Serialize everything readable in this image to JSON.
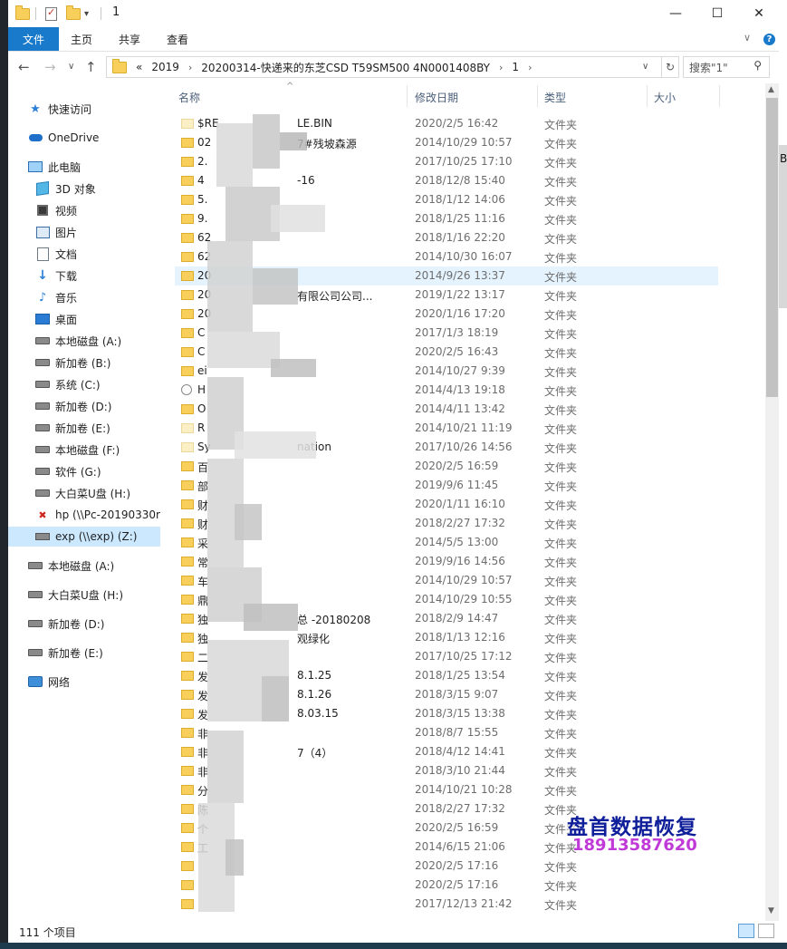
{
  "window": {
    "title": "1",
    "minimize_icon": "minimize-icon",
    "maximize_icon": "maximize-icon",
    "close_icon": "close-icon",
    "min_glyph": "—",
    "max_glyph": "☐",
    "close_glyph": "✕"
  },
  "ribbon": {
    "tabs": [
      "文件",
      "主页",
      "共享",
      "查看"
    ],
    "collapse_glyph": "∨",
    "help_glyph": "?"
  },
  "address": {
    "back_glyph": "←",
    "forward_glyph": "→",
    "recent_glyph": "∨",
    "up_glyph": "↑",
    "overflow": "«",
    "crumbs": [
      "2019",
      "20200314-快递来的东芝CSD T59SM500 4N0001408BY",
      "1"
    ],
    "chevron": "›",
    "dropdown_glyph": "∨",
    "refresh_glyph": "↻",
    "search_placeholder": "搜索\"1\"",
    "search_glyph": "⚲"
  },
  "nav": {
    "items": [
      {
        "label": "快速访问",
        "icon": "star-icon"
      },
      {
        "label": "OneDrive",
        "icon": "cloud-icon"
      },
      {
        "label": "此电脑",
        "icon": "computer-icon"
      },
      {
        "label": "3D 对象",
        "icon": "cube-icon"
      },
      {
        "label": "视频",
        "icon": "video-icon"
      },
      {
        "label": "图片",
        "icon": "picture-icon"
      },
      {
        "label": "文档",
        "icon": "document-icon"
      },
      {
        "label": "下载",
        "icon": "download-icon"
      },
      {
        "label": "音乐",
        "icon": "music-icon"
      },
      {
        "label": "桌面",
        "icon": "desktop-icon"
      },
      {
        "label": "本地磁盘 (A:)",
        "icon": "drive-icon"
      },
      {
        "label": "新加卷 (B:)",
        "icon": "drive-icon"
      },
      {
        "label": "系统 (C:)",
        "icon": "drive-icon"
      },
      {
        "label": "新加卷 (D:)",
        "icon": "drive-icon"
      },
      {
        "label": "新加卷 (E:)",
        "icon": "drive-icon"
      },
      {
        "label": "本地磁盘 (F:)",
        "icon": "drive-icon"
      },
      {
        "label": "软件 (G:)",
        "icon": "drive-icon"
      },
      {
        "label": "大白菜U盘 (H:)",
        "icon": "drive-icon"
      },
      {
        "label": "hp (\\\\Pc-20190330r",
        "icon": "disconnected-drive-icon"
      },
      {
        "label": "exp (\\\\exp) (Z:)",
        "icon": "network-drive-icon"
      },
      {
        "label": "本地磁盘 (A:)",
        "icon": "drive-icon"
      },
      {
        "label": "大白菜U盘 (H:)",
        "icon": "drive-icon"
      },
      {
        "label": "新加卷 (D:)",
        "icon": "drive-icon"
      },
      {
        "label": "新加卷 (E:)",
        "icon": "drive-icon"
      },
      {
        "label": "网络",
        "icon": "network-icon"
      }
    ]
  },
  "columns": {
    "name": "名称",
    "date": "修改日期",
    "type": "类型",
    "size": "大小",
    "sort_glyph": "^"
  },
  "files": [
    {
      "name": "$RE",
      "name2": "LE.BIN",
      "date": "2020/2/5 16:42",
      "type": "文件夹"
    },
    {
      "name": "02",
      "name2": "7#残坡森源",
      "date": "2014/10/29 10:57",
      "type": "文件夹"
    },
    {
      "name": "2.",
      "name2": "",
      "date": "2017/10/25 17:10",
      "type": "文件夹"
    },
    {
      "name": "4",
      "name2": "-16",
      "date": "2018/12/8 15:40",
      "type": "文件夹"
    },
    {
      "name": "5.",
      "name2": "",
      "date": "2018/1/12 14:06",
      "type": "文件夹"
    },
    {
      "name": "9.",
      "name2": "",
      "date": "2018/1/25 11:16",
      "type": "文件夹"
    },
    {
      "name": "62",
      "name2": "",
      "date": "2018/1/16 22:20",
      "type": "文件夹"
    },
    {
      "name": "62",
      "name2": "",
      "date": "2014/10/30 16:07",
      "type": "文件夹"
    },
    {
      "name": "20",
      "name2": "",
      "date": "2014/9/26 13:37",
      "type": "文件夹"
    },
    {
      "name": "20",
      "name2": "有限公司公司...",
      "date": "2019/1/22 13:17",
      "type": "文件夹"
    },
    {
      "name": "20",
      "name2": "",
      "date": "2020/1/16 17:20",
      "type": "文件夹"
    },
    {
      "name": "C",
      "name2": "",
      "date": "2017/1/3 18:19",
      "type": "文件夹"
    },
    {
      "name": "C",
      "name2": "",
      "date": "2020/2/5 16:43",
      "type": "文件夹"
    },
    {
      "name": "ei",
      "name2": "",
      "date": "2014/10/27 9:39",
      "type": "文件夹"
    },
    {
      "name": "H",
      "name2": "",
      "date": "2014/4/13 19:18",
      "type": "文件夹"
    },
    {
      "name": "O",
      "name2": "",
      "date": "2014/4/11 13:42",
      "type": "文件夹"
    },
    {
      "name": "R",
      "name2": "",
      "date": "2014/10/21 11:19",
      "type": "文件夹"
    },
    {
      "name": "Sy",
      "name2": "nation",
      "date": "2017/10/26 14:56",
      "type": "文件夹"
    },
    {
      "name": "百",
      "name2": "",
      "date": "2020/2/5 16:59",
      "type": "文件夹"
    },
    {
      "name": "部",
      "name2": "",
      "date": "2019/9/6 11:45",
      "type": "文件夹"
    },
    {
      "name": "财",
      "name2": "",
      "date": "2020/1/11 16:10",
      "type": "文件夹"
    },
    {
      "name": "财",
      "name2": "",
      "date": "2018/2/27 17:32",
      "type": "文件夹"
    },
    {
      "name": "采",
      "name2": "",
      "date": "2014/5/5 13:00",
      "type": "文件夹"
    },
    {
      "name": "常",
      "name2": "",
      "date": "2019/9/16 14:56",
      "type": "文件夹"
    },
    {
      "name": "车",
      "name2": "",
      "date": "2014/10/29 10:57",
      "type": "文件夹"
    },
    {
      "name": "鼎",
      "name2": "",
      "date": "2014/10/29 10:55",
      "type": "文件夹"
    },
    {
      "name": "独",
      "name2": "总 -20180208",
      "date": "2018/2/9 14:47",
      "type": "文件夹"
    },
    {
      "name": "独",
      "name2": "观绿化",
      "date": "2018/1/13 12:16",
      "type": "文件夹"
    },
    {
      "name": "二",
      "name2": "",
      "date": "2017/10/25 17:12",
      "type": "文件夹"
    },
    {
      "name": "发",
      "name2": "8.1.25",
      "date": "2018/1/25 13:54",
      "type": "文件夹"
    },
    {
      "name": "发",
      "name2": "8.1.26",
      "date": "2018/3/15 9:07",
      "type": "文件夹"
    },
    {
      "name": "发",
      "name2": "8.03.15",
      "date": "2018/3/15 13:38",
      "type": "文件夹"
    },
    {
      "name": "非",
      "name2": "",
      "date": "2018/8/7 15:55",
      "type": "文件夹"
    },
    {
      "name": "非",
      "name2": "7（4）",
      "date": "2018/4/12 14:41",
      "type": "文件夹"
    },
    {
      "name": "非",
      "name2": "",
      "date": "2018/3/10 21:44",
      "type": "文件夹"
    },
    {
      "name": "分",
      "name2": "",
      "date": "2014/10/21 10:28",
      "type": "文件夹"
    },
    {
      "name": "陈",
      "name2": "",
      "date": "2018/2/27 17:32",
      "type": "文件夹"
    },
    {
      "name": "个",
      "name2": "",
      "date": "2020/2/5 16:59",
      "type": "文件夹"
    },
    {
      "name": "工",
      "name2": "",
      "date": "2014/6/15 21:06",
      "type": "文件夹"
    },
    {
      "name": "",
      "name2": "",
      "date": "2020/2/5 17:16",
      "type": "文件夹"
    },
    {
      "name": "",
      "name2": "",
      "date": "2020/2/5 17:16",
      "type": "文件夹"
    },
    {
      "name": "",
      "name2": "",
      "date": "2017/12/13 21:42",
      "type": "文件夹"
    }
  ],
  "status": {
    "count": "111 个项目"
  },
  "watermark": {
    "line1": "盘首数据恢复",
    "line2": "18913587620"
  },
  "behind_window_text": "B"
}
